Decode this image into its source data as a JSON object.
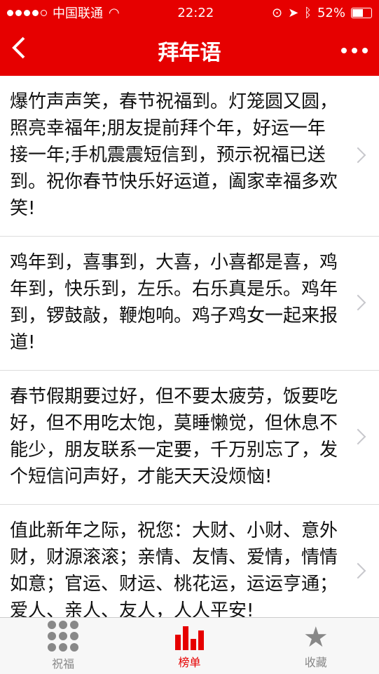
{
  "status_bar": {
    "carrier": "中国联通",
    "time": "22:22",
    "battery": "52%"
  },
  "nav": {
    "title": "拜年语",
    "back_icon": "chevron-left-icon",
    "more_icon": "more-dots-icon"
  },
  "greetings": [
    {
      "text": "爆竹声声笑，春节祝福到。灯笼圆又圆，照亮幸福年;朋友提前拜个年，好运一年接一年;手机震震短信到，预示祝福已送到。祝你春节快乐好运道，阖家幸福多欢笑!"
    },
    {
      "text": "鸡年到，喜事到，大喜，小喜都是喜，鸡年到，快乐到，左乐。右乐真是乐。鸡年到，锣鼓敲，鞭炮响。鸡子鸡女一起来报道!"
    },
    {
      "text": "春节假期要过好，但不要太疲劳，饭要吃好，但不用吃太饱，莫睡懒觉，但休息不能少，朋友联系一定要，千万别忘了，发个短信问声好，才能天天没烦恼!"
    },
    {
      "text": "值此新年之际，祝您：大财、小财、意外财，财源滚滚；亲情、友情、爱情，情情如意；官运、财运、桃花运，运运亨通；爱人、亲人、友人，人人平安!"
    }
  ],
  "tabs": [
    {
      "label": "祝福",
      "icon": "grid-icon"
    },
    {
      "label": "榜单",
      "icon": "bar-chart-icon"
    },
    {
      "label": "收藏",
      "icon": "star-icon"
    }
  ],
  "colors": {
    "accent": "#e60000"
  }
}
